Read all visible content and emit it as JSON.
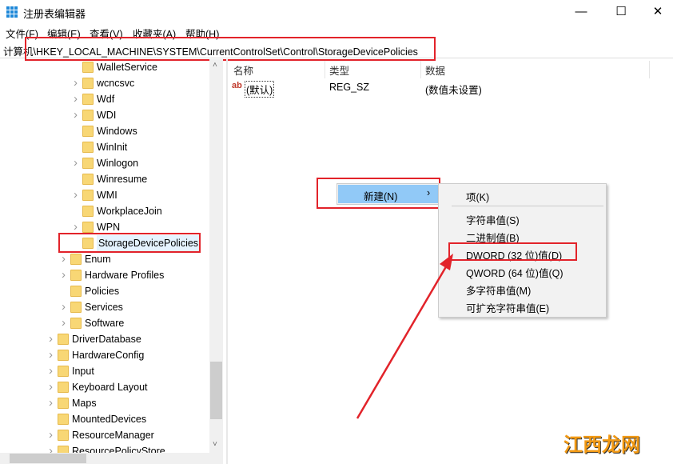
{
  "window": {
    "title": "注册表编辑器",
    "minimize": "—",
    "maximize": "☐",
    "close": "✕"
  },
  "menu": [
    "文件(F)",
    "编辑(E)",
    "查看(V)",
    "收藏夹(A)",
    "帮助(H)"
  ],
  "address": "计算机\\HKEY_LOCAL_MACHINE\\SYSTEM\\CurrentControlSet\\Control\\StorageDevicePolicies",
  "tree": [
    {
      "label": "WalletService",
      "level": 3,
      "expandable": false
    },
    {
      "label": "wcncsvc",
      "level": 3,
      "expandable": true
    },
    {
      "label": "Wdf",
      "level": 3,
      "expandable": true
    },
    {
      "label": "WDI",
      "level": 3,
      "expandable": true
    },
    {
      "label": "Windows",
      "level": 3,
      "expandable": false
    },
    {
      "label": "WinInit",
      "level": 3,
      "expandable": false
    },
    {
      "label": "Winlogon",
      "level": 3,
      "expandable": true
    },
    {
      "label": "Winresume",
      "level": 3,
      "expandable": false
    },
    {
      "label": "WMI",
      "level": 3,
      "expandable": true
    },
    {
      "label": "WorkplaceJoin",
      "level": 3,
      "expandable": false
    },
    {
      "label": "WPN",
      "level": 3,
      "expandable": true
    },
    {
      "label": "StorageDevicePolicies",
      "level": 3,
      "expandable": false,
      "selected": true
    },
    {
      "label": "Enum",
      "level": 2,
      "expandable": true
    },
    {
      "label": "Hardware Profiles",
      "level": 2,
      "expandable": true
    },
    {
      "label": "Policies",
      "level": 2,
      "expandable": false
    },
    {
      "label": "Services",
      "level": 2,
      "expandable": true
    },
    {
      "label": "Software",
      "level": 2,
      "expandable": true
    },
    {
      "label": "DriverDatabase",
      "level": 1,
      "expandable": true
    },
    {
      "label": "HardwareConfig",
      "level": 1,
      "expandable": true
    },
    {
      "label": "Input",
      "level": 1,
      "expandable": true
    },
    {
      "label": "Keyboard Layout",
      "level": 1,
      "expandable": true
    },
    {
      "label": "Maps",
      "level": 1,
      "expandable": true
    },
    {
      "label": "MountedDevices",
      "level": 1,
      "expandable": false
    },
    {
      "label": "ResourceManager",
      "level": 1,
      "expandable": true
    },
    {
      "label": "ResourcePolicyStore",
      "level": 1,
      "expandable": true
    }
  ],
  "columns": {
    "name": "名称",
    "type": "类型",
    "data": "数据"
  },
  "values": [
    {
      "icon": "ab",
      "name": "(默认)",
      "type": "REG_SZ",
      "data": "(数值未设置)"
    }
  ],
  "context_menu": {
    "new": "新建(N)",
    "arrow": "›"
  },
  "submenu": [
    "项(K)",
    "字符串值(S)",
    "二进制值(B)",
    "DWORD (32 位)值(D)",
    "QWORD (64 位)值(Q)",
    "多字符串值(M)",
    "可扩充字符串值(E)"
  ],
  "watermark": "江西龙网",
  "colors": {
    "highlight": "#e2232a",
    "menu_hover": "#91c9f7",
    "folder": "#f8d775"
  }
}
